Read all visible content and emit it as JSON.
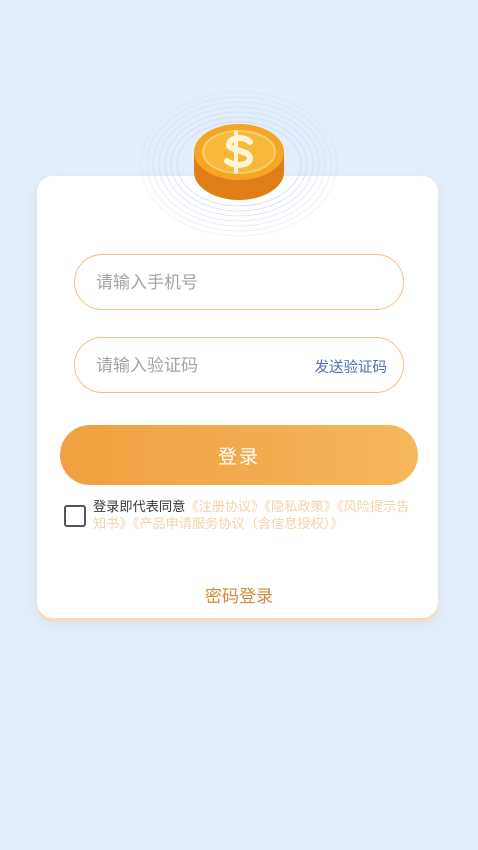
{
  "login_form": {
    "phone_placeholder": "请输入手机号",
    "code_placeholder": "请输入验证码",
    "send_code_label": "发送验证码",
    "login_button_label": "登录"
  },
  "agreement": {
    "prefix": "登录即代表同意",
    "links": [
      "《注册协议》",
      "《隐私政策》",
      "《风险提示告知书》",
      "《产品申请服务协议（含信息授权）》"
    ]
  },
  "password_login_label": "密码登录",
  "icons": {
    "hero": "gold-coin-icon"
  },
  "colors": {
    "background": "#e3eefc",
    "accent": "#f0a040",
    "input_border": "#f0c08a",
    "send_code": "#4e6fb2",
    "agreement_link": "#f2d3ad",
    "password_login": "#d08a3c"
  }
}
